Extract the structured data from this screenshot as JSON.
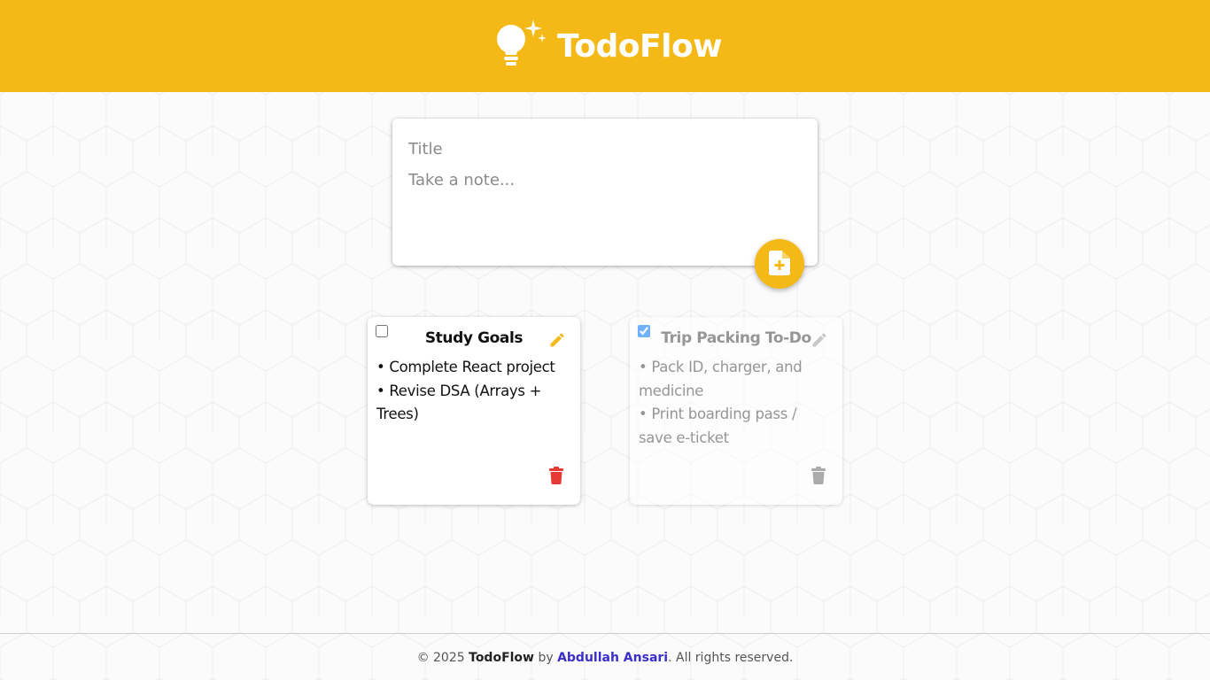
{
  "header": {
    "title": "TodoFlow",
    "logo_icon": "lightbulb-sparkle-icon",
    "bg_color": "#f4b916"
  },
  "composer": {
    "title_placeholder": "Title",
    "note_placeholder": "Take a note...",
    "add_icon": "add-note-icon"
  },
  "notes": [
    {
      "title": "Study Goals",
      "checked": false,
      "lines": [
        "• Complete React project",
        "• Revise DSA (Arrays + Trees)"
      ],
      "edit_icon": "pencil-icon",
      "delete_icon": "trash-icon",
      "edit_color": "#f4b916",
      "delete_color": "#e53935"
    },
    {
      "title": "Trip Packing To-Do",
      "checked": true,
      "lines": [
        "• Pack ID, charger, and medicine",
        "• Print boarding pass / save e-ticket"
      ],
      "edit_icon": "pencil-icon",
      "delete_icon": "trash-icon",
      "edit_color": "#9e9e9e",
      "delete_color": "#6b6b6b"
    }
  ],
  "footer": {
    "prefix": "© 2025",
    "brand": "TodoFlow",
    "by": "by",
    "author": "Abdullah Ansari",
    "suffix": ". All rights reserved."
  }
}
